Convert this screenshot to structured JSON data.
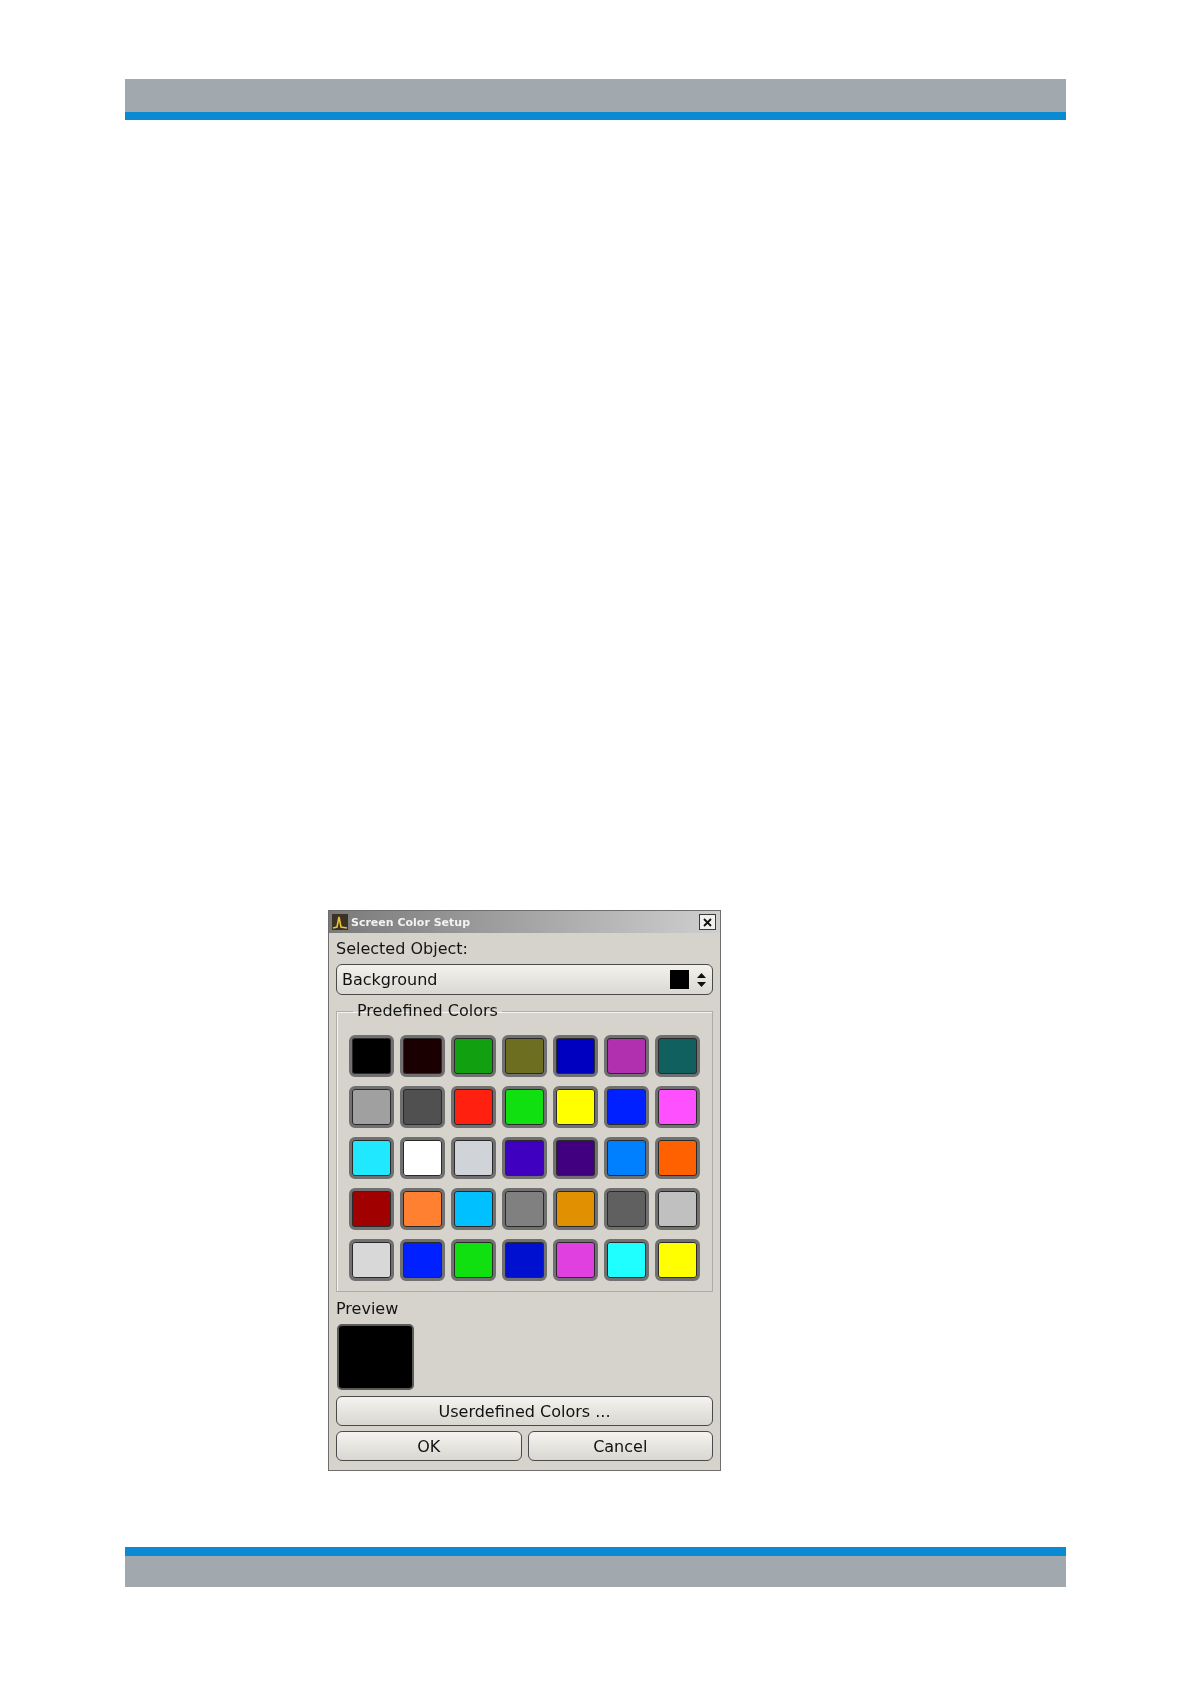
{
  "window": {
    "title": "Screen Color Setup"
  },
  "selected_object": {
    "label": "Selected Object:",
    "value": "Background",
    "color": "#000000"
  },
  "predefined_colors": {
    "title": "Predefined Colors",
    "swatches": [
      {
        "color": "#000000"
      },
      {
        "color": "#1a0000"
      },
      {
        "color": "#10a010"
      },
      {
        "color": "#6e6e20"
      },
      {
        "color": "#0000c0"
      },
      {
        "color": "#b030b0"
      },
      {
        "color": "#106060"
      },
      {
        "color": "#a0a0a0"
      },
      {
        "color": "#505050"
      },
      {
        "color": "#ff2010"
      },
      {
        "color": "#10e010"
      },
      {
        "color": "#ffff00"
      },
      {
        "color": "#0020ff"
      },
      {
        "color": "#ff50ff"
      },
      {
        "color": "#20e8ff"
      },
      {
        "color": "#ffffff"
      },
      {
        "color": "#d0d4d8"
      },
      {
        "color": "#4000c0"
      },
      {
        "color": "#400080"
      },
      {
        "color": "#0080ff"
      },
      {
        "color": "#ff6000"
      },
      {
        "color": "#a00000"
      },
      {
        "color": "#ff8030"
      },
      {
        "color": "#00c0ff"
      },
      {
        "color": "#808080"
      },
      {
        "color": "#e09000"
      },
      {
        "color": "#606060"
      },
      {
        "color": "#c0c0c0"
      },
      {
        "color": "#d8d8d8"
      },
      {
        "color": "#0020ff"
      },
      {
        "color": "#10e010"
      },
      {
        "color": "#0010d0"
      },
      {
        "color": "#e040e0"
      },
      {
        "color": "#20ffff"
      },
      {
        "color": "#ffff00"
      }
    ]
  },
  "preview": {
    "label": "Preview",
    "color": "#000000"
  },
  "buttons": [
    "Userdefined Colors ...",
    "OK",
    "Cancel"
  ]
}
